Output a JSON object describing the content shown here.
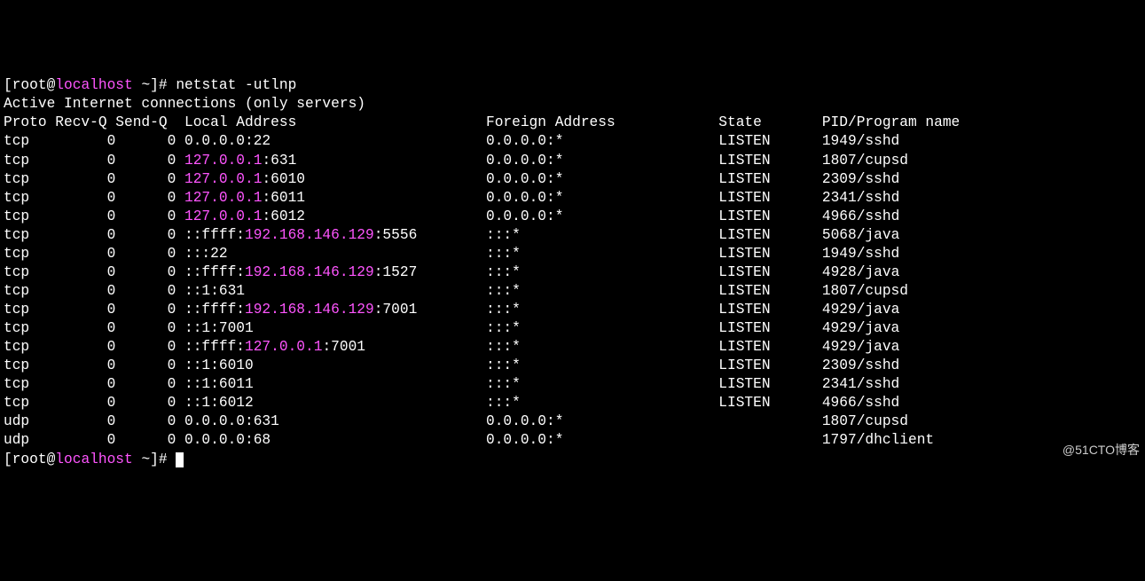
{
  "prompt": {
    "open": "[",
    "user": "root",
    "at": "@",
    "host": "localhost",
    "dirmark": " ~]",
    "hash": "# "
  },
  "command": "netstat -utlnp",
  "subheader": "Active Internet connections (only servers)",
  "header": {
    "proto": "Proto",
    "recvq": "Recv-Q",
    "sendq": "Send-Q",
    "local": "Local Address",
    "foreign": "Foreign Address",
    "state": "State",
    "pid": "PID/Program name"
  },
  "rows": [
    {
      "proto": "tcp",
      "recvq": "0",
      "sendq": "0",
      "lpre": "0.0.0.0:22",
      "lhl": "",
      "lpost": "",
      "foreign": "0.0.0.0:*",
      "state": "LISTEN",
      "pid": "1949/sshd"
    },
    {
      "proto": "tcp",
      "recvq": "0",
      "sendq": "0",
      "lpre": "",
      "lhl": "127.0.0.1",
      "lpost": ":631",
      "foreign": "0.0.0.0:*",
      "state": "LISTEN",
      "pid": "1807/cupsd"
    },
    {
      "proto": "tcp",
      "recvq": "0",
      "sendq": "0",
      "lpre": "",
      "lhl": "127.0.0.1",
      "lpost": ":6010",
      "foreign": "0.0.0.0:*",
      "state": "LISTEN",
      "pid": "2309/sshd"
    },
    {
      "proto": "tcp",
      "recvq": "0",
      "sendq": "0",
      "lpre": "",
      "lhl": "127.0.0.1",
      "lpost": ":6011",
      "foreign": "0.0.0.0:*",
      "state": "LISTEN",
      "pid": "2341/sshd"
    },
    {
      "proto": "tcp",
      "recvq": "0",
      "sendq": "0",
      "lpre": "",
      "lhl": "127.0.0.1",
      "lpost": ":6012",
      "foreign": "0.0.0.0:*",
      "state": "LISTEN",
      "pid": "4966/sshd"
    },
    {
      "proto": "tcp",
      "recvq": "0",
      "sendq": "0",
      "lpre": "::ffff:",
      "lhl": "192.168.146.129",
      "lpost": ":5556",
      "foreign": ":::*",
      "state": "LISTEN",
      "pid": "5068/java"
    },
    {
      "proto": "tcp",
      "recvq": "0",
      "sendq": "0",
      "lpre": ":::22",
      "lhl": "",
      "lpost": "",
      "foreign": ":::*",
      "state": "LISTEN",
      "pid": "1949/sshd"
    },
    {
      "proto": "tcp",
      "recvq": "0",
      "sendq": "0",
      "lpre": "::ffff:",
      "lhl": "192.168.146.129",
      "lpost": ":1527",
      "foreign": ":::*",
      "state": "LISTEN",
      "pid": "4928/java"
    },
    {
      "proto": "tcp",
      "recvq": "0",
      "sendq": "0",
      "lpre": "::1:631",
      "lhl": "",
      "lpost": "",
      "foreign": ":::*",
      "state": "LISTEN",
      "pid": "1807/cupsd"
    },
    {
      "proto": "tcp",
      "recvq": "0",
      "sendq": "0",
      "lpre": "::ffff:",
      "lhl": "192.168.146.129",
      "lpost": ":7001",
      "foreign": ":::*",
      "state": "LISTEN",
      "pid": "4929/java"
    },
    {
      "proto": "tcp",
      "recvq": "0",
      "sendq": "0",
      "lpre": "::1:7001",
      "lhl": "",
      "lpost": "",
      "foreign": ":::*",
      "state": "LISTEN",
      "pid": "4929/java"
    },
    {
      "proto": "tcp",
      "recvq": "0",
      "sendq": "0",
      "lpre": "::ffff:",
      "lhl": "127.0.0.1",
      "lpost": ":7001",
      "foreign": ":::*",
      "state": "LISTEN",
      "pid": "4929/java"
    },
    {
      "proto": "tcp",
      "recvq": "0",
      "sendq": "0",
      "lpre": "::1:6010",
      "lhl": "",
      "lpost": "",
      "foreign": ":::*",
      "state": "LISTEN",
      "pid": "2309/sshd"
    },
    {
      "proto": "tcp",
      "recvq": "0",
      "sendq": "0",
      "lpre": "::1:6011",
      "lhl": "",
      "lpost": "",
      "foreign": ":::*",
      "state": "LISTEN",
      "pid": "2341/sshd"
    },
    {
      "proto": "tcp",
      "recvq": "0",
      "sendq": "0",
      "lpre": "::1:6012",
      "lhl": "",
      "lpost": "",
      "foreign": ":::*",
      "state": "LISTEN",
      "pid": "4966/sshd"
    },
    {
      "proto": "udp",
      "recvq": "0",
      "sendq": "0",
      "lpre": "0.0.0.0:631",
      "lhl": "",
      "lpost": "",
      "foreign": "0.0.0.0:*",
      "state": "",
      "pid": "1807/cupsd"
    },
    {
      "proto": "udp",
      "recvq": "0",
      "sendq": "0",
      "lpre": "0.0.0.0:68",
      "lhl": "",
      "lpost": "",
      "foreign": "0.0.0.0:*",
      "state": "",
      "pid": "1797/dhclient"
    }
  ],
  "watermark": "@51CTO博客"
}
